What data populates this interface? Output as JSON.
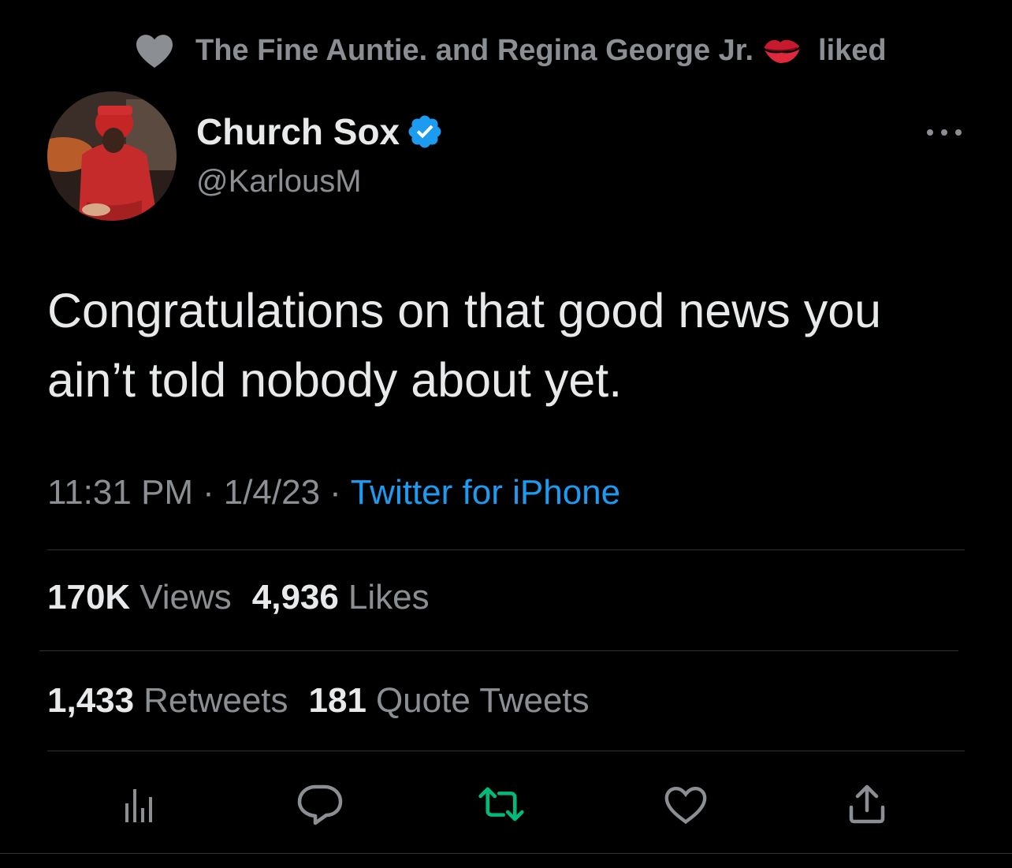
{
  "social_context": {
    "names": "The Fine Auntie. and Regina George Jr.",
    "action": "liked",
    "icon": "heart-icon",
    "emoji": "kiss-mark-emoji"
  },
  "author": {
    "display_name": "Church Sox",
    "handle": "@KarlousM",
    "verified": true
  },
  "tweet": {
    "line1": "Congratulations on that good news you",
    "line2": "ain’t told nobody about yet."
  },
  "meta": {
    "time": "11:31 PM",
    "dot1": "·",
    "date": "1/4/23",
    "dot2": "·",
    "client": "Twitter for iPhone"
  },
  "stats": {
    "views_count": "170K",
    "views_label": "Views",
    "likes_count": "4,936",
    "likes_label": "Likes",
    "retweets_count": "1,433",
    "retweets_label": "Retweets",
    "quotes_count": "181",
    "quotes_label": "Quote Tweets"
  },
  "colors": {
    "background": "#000000",
    "primary_text": "#e7e9ea",
    "secondary_text": "#8b8f93",
    "link": "#1d9bf0",
    "retweet_active": "#00ba7c",
    "divider": "#2f3336"
  },
  "actions": [
    "analytics-icon",
    "reply-icon",
    "retweet-icon",
    "like-icon",
    "share-icon"
  ]
}
